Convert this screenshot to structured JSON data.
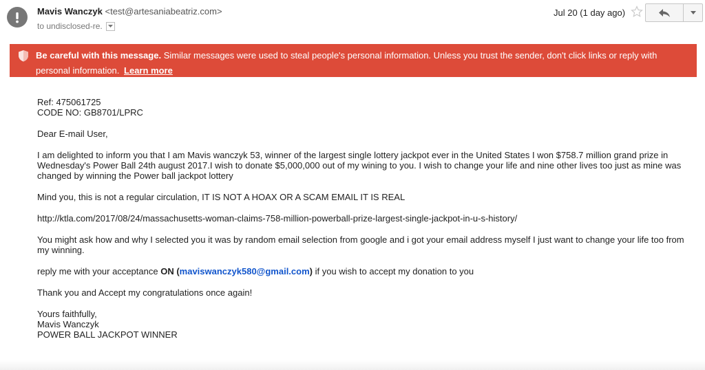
{
  "header": {
    "sender_name": "Mavis Wanczyk",
    "sender_email": "<test@artesaniabeatriz.com>",
    "recipient": "to undisclosed-re.",
    "date": "Jul 20 (1 day ago)"
  },
  "icons": {
    "avatar": "warning-avatar-icon",
    "star": "star-icon",
    "reply": "reply-arrow-icon",
    "more": "dropdown-arrow-icon",
    "shield": "shield-warning-icon"
  },
  "warning": {
    "bold": "Be careful with this message.",
    "text": "Similar messages were used to steal people's personal information. Unless you trust the sender, don't click links or reply with personal information.",
    "link": "Learn more",
    "color": "#dd4b39"
  },
  "body": {
    "ref": "Ref: 475061725",
    "code": "CODE NO: GB8701/LPRC",
    "greeting": "Dear E-mail User,",
    "para1": "I am delighted to inform you that I am Mavis wanczyk 53, winner of the largest single lottery jackpot ever in the United States I won $758.7 million grand prize in Wednesday's Power Ball 24th august 2017.I wish to donate $5,000,000 out of my wining to you. I wish to change your life and nine other lives too just as mine was changed by winning the Power ball jackpot lottery",
    "para2": "Mind you, this is not a regular circulation, IT IS NOT A HOAX OR A SCAM EMAIL IT IS REAL",
    "url": "http://ktla.com/2017/08/24/massachusetts-woman-claims-758-million-powerball-prize-largest-single-jackpot-in-u-s-history/",
    "para3": "You might ask how and why I selected you it was by random email selection from google and i got your email address myself I just want to change your life too from my winning.",
    "reply_pre": "reply me with your acceptance ",
    "reply_on": "ON",
    "reply_open": " (",
    "reply_email": "maviswanczyk580@gmail.com",
    "reply_close": ")",
    "reply_post": " if you wish to accept my donation to you",
    "thanks": "Thank you and Accept my congratulations once again!",
    "closing": "Yours faithfully,",
    "sig_name": "Mavis Wanczyk",
    "sig_title": "POWER BALL JACKPOT WINNER"
  }
}
